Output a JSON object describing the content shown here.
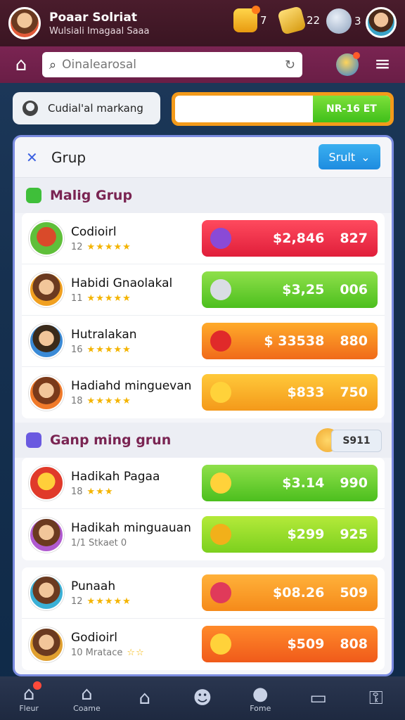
{
  "header": {
    "player_name": "Poaar Solriat",
    "player_sub": "Wulsiali Imagaal Saaa",
    "stat1": "7",
    "stat2": "22",
    "stat3": "3"
  },
  "search": {
    "placeholder": "Oinalearosal"
  },
  "filter_chip": "Cudial'al markang",
  "progress": {
    "value_label": "NR-16 ET",
    "fill_fraction": 0.36
  },
  "panel": {
    "title": "Grup",
    "sort_label": "Srult",
    "section1_title": "Malig Grup",
    "section2_title": "Ganp ming grun",
    "section2_button": "S911"
  },
  "rows": [
    {
      "name": "Codioirl",
      "sub": "12",
      "stars": "★★★★★",
      "amount": "$2,846",
      "count": "827",
      "color": "pill-red"
    },
    {
      "name": "Habidi Gnaolakal",
      "sub": "11",
      "stars": "★★★★★",
      "amount": "$3,25",
      "count": "006",
      "color": "pill-green"
    },
    {
      "name": "Hutralakan",
      "sub": "16",
      "stars": "★★★★★",
      "amount": "$ 33538",
      "count": "880",
      "color": "pill-orange"
    },
    {
      "name": "Hadiahd minguevan",
      "sub": "18",
      "stars": "★★★★★",
      "amount": "$833",
      "count": "750",
      "color": "pill-amber"
    }
  ],
  "rows2": [
    {
      "name": "Hadikah Pagaa",
      "sub": "18",
      "stars": "★★★",
      "amount": "$3.14",
      "count": "990",
      "color": "pill-green"
    },
    {
      "name": "Hadikah minguauan",
      "sub": "1/1 Stkaet 0",
      "stars": "",
      "amount": "$299",
      "count": "925",
      "color": "pill-lime"
    }
  ],
  "rows3": [
    {
      "name": "Punaah",
      "sub": "12",
      "stars": "★★★★★",
      "amount": "$08.26",
      "count": "509",
      "color": "pill-orange2"
    },
    {
      "name": "Godioirl",
      "sub": "10 Mratace",
      "stars": "☆☆",
      "amount": "$509",
      "count": "808",
      "color": "pill-deep"
    }
  ],
  "tabs": [
    {
      "icon": "⌂",
      "label": "Fleur",
      "name": "home"
    },
    {
      "icon": "⌂",
      "label": "Coame",
      "name": "game"
    },
    {
      "icon": "⌂",
      "label": "",
      "name": "house"
    },
    {
      "icon": "☻",
      "label": "",
      "name": "chat"
    },
    {
      "icon": "●",
      "label": "Fome",
      "name": "pin"
    },
    {
      "icon": "▭",
      "label": "",
      "name": "screen"
    },
    {
      "icon": "⚿",
      "label": "",
      "name": "lock"
    }
  ]
}
